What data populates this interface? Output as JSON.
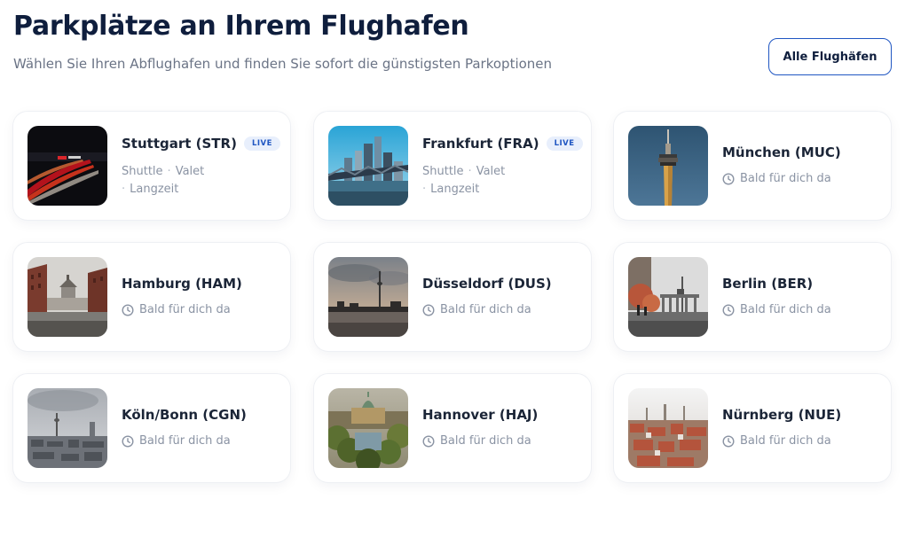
{
  "header": {
    "title": "Parkplätze an Ihrem Flughafen",
    "subtitle": "Wählen Sie Ihren Abflughafen und finden Sie sofort die günstigsten Parkoptionen",
    "all_airports_label": "Alle Flughäfen"
  },
  "live_badge": "LIVE",
  "soon_text": "Bald für dich da",
  "airports": [
    {
      "name": "Stuttgart (STR)",
      "live": true,
      "services": [
        "Shuttle",
        "Valet",
        "Langzeit"
      ]
    },
    {
      "name": "Frankfurt (FRA)",
      "live": true,
      "services": [
        "Shuttle",
        "Valet",
        "Langzeit"
      ]
    },
    {
      "name": "München (MUC)",
      "live": false
    },
    {
      "name": "Hamburg (HAM)",
      "live": false
    },
    {
      "name": "Düsseldorf (DUS)",
      "live": false
    },
    {
      "name": "Berlin (BER)",
      "live": false
    },
    {
      "name": "Köln/Bonn (CGN)",
      "live": false
    },
    {
      "name": "Hannover (HAJ)",
      "live": false
    },
    {
      "name": "Nürnberg (NUE)",
      "live": false
    }
  ],
  "colors": {
    "primary": "#1f56c2",
    "title": "#0f1e3d",
    "muted": "#8a93a3",
    "badge_bg": "#e8effc"
  }
}
